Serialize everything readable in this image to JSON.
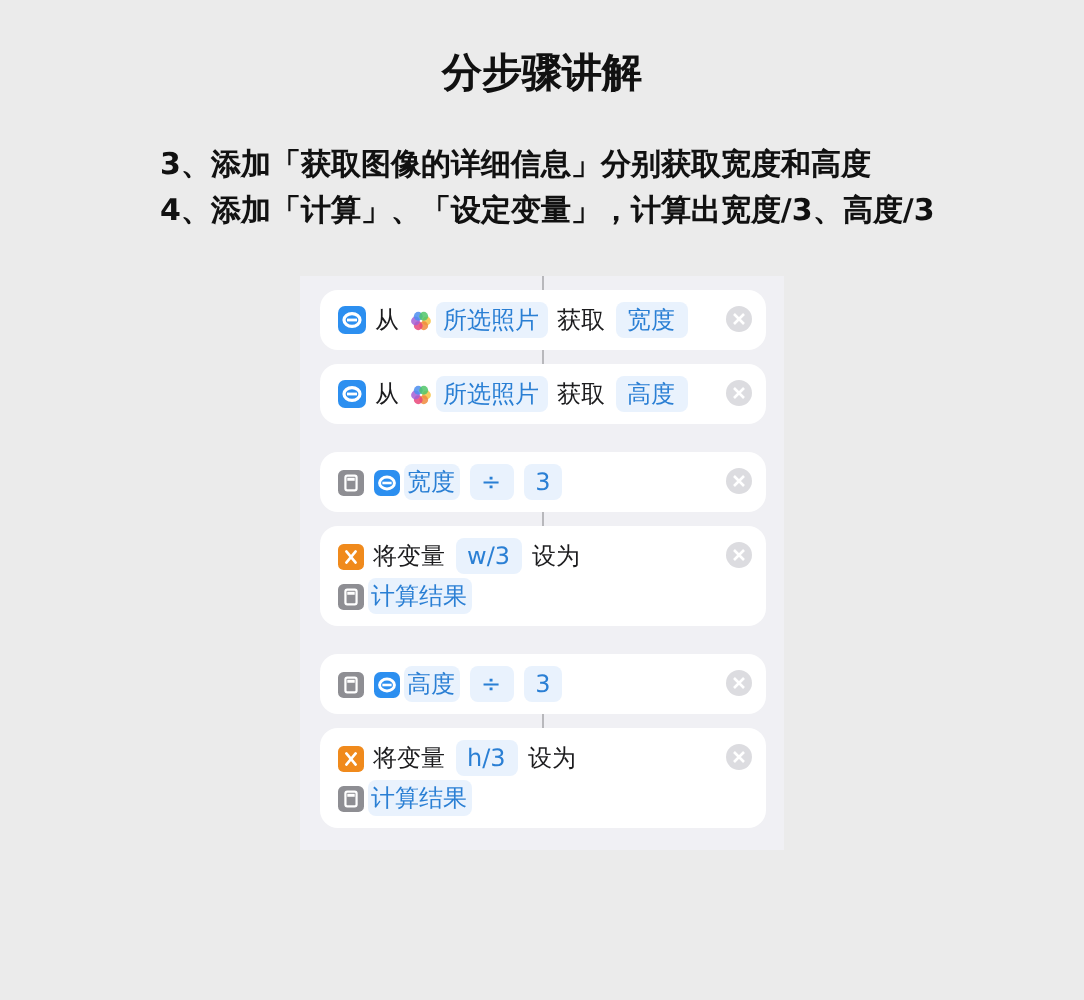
{
  "title": "分步骤讲解",
  "steps": [
    "3、添加「获取图像的详细信息」分别获取宽度和高度",
    "4、添加「计算」、「设定变量」，计算出宽度/3、高度/3"
  ],
  "groups": [
    [
      {
        "kind": "detail",
        "lines": [
          [
            {
              "kind": "text",
              "text": "从"
            },
            {
              "kind": "photos",
              "text": "所选照片"
            },
            {
              "kind": "text",
              "text": "获取"
            },
            {
              "kind": "token",
              "text": "宽度"
            }
          ]
        ]
      },
      {
        "kind": "detail",
        "lines": [
          [
            {
              "kind": "text",
              "text": "从"
            },
            {
              "kind": "photos",
              "text": "所选照片"
            },
            {
              "kind": "text",
              "text": "获取"
            },
            {
              "kind": "token",
              "text": "高度"
            }
          ]
        ]
      }
    ],
    [
      {
        "kind": "calculate",
        "lines": [
          [
            {
              "kind": "detail_token",
              "text": "宽度"
            },
            {
              "kind": "token",
              "text": "÷"
            },
            {
              "kind": "token",
              "text": "3"
            }
          ]
        ]
      },
      {
        "kind": "variable",
        "lines": [
          [
            {
              "kind": "text",
              "text": "将变量"
            },
            {
              "kind": "token",
              "text": "w/3"
            },
            {
              "kind": "text",
              "text": "设为"
            }
          ],
          [
            {
              "kind": "calc_token",
              "text": "计算结果"
            }
          ]
        ]
      }
    ],
    [
      {
        "kind": "calculate",
        "lines": [
          [
            {
              "kind": "detail_token",
              "text": "高度"
            },
            {
              "kind": "token",
              "text": "÷"
            },
            {
              "kind": "token",
              "text": "3"
            }
          ]
        ]
      },
      {
        "kind": "variable",
        "lines": [
          [
            {
              "kind": "text",
              "text": "将变量"
            },
            {
              "kind": "token",
              "text": "h/3"
            },
            {
              "kind": "text",
              "text": "设为"
            }
          ],
          [
            {
              "kind": "calc_token",
              "text": "计算结果"
            }
          ]
        ]
      }
    ]
  ]
}
